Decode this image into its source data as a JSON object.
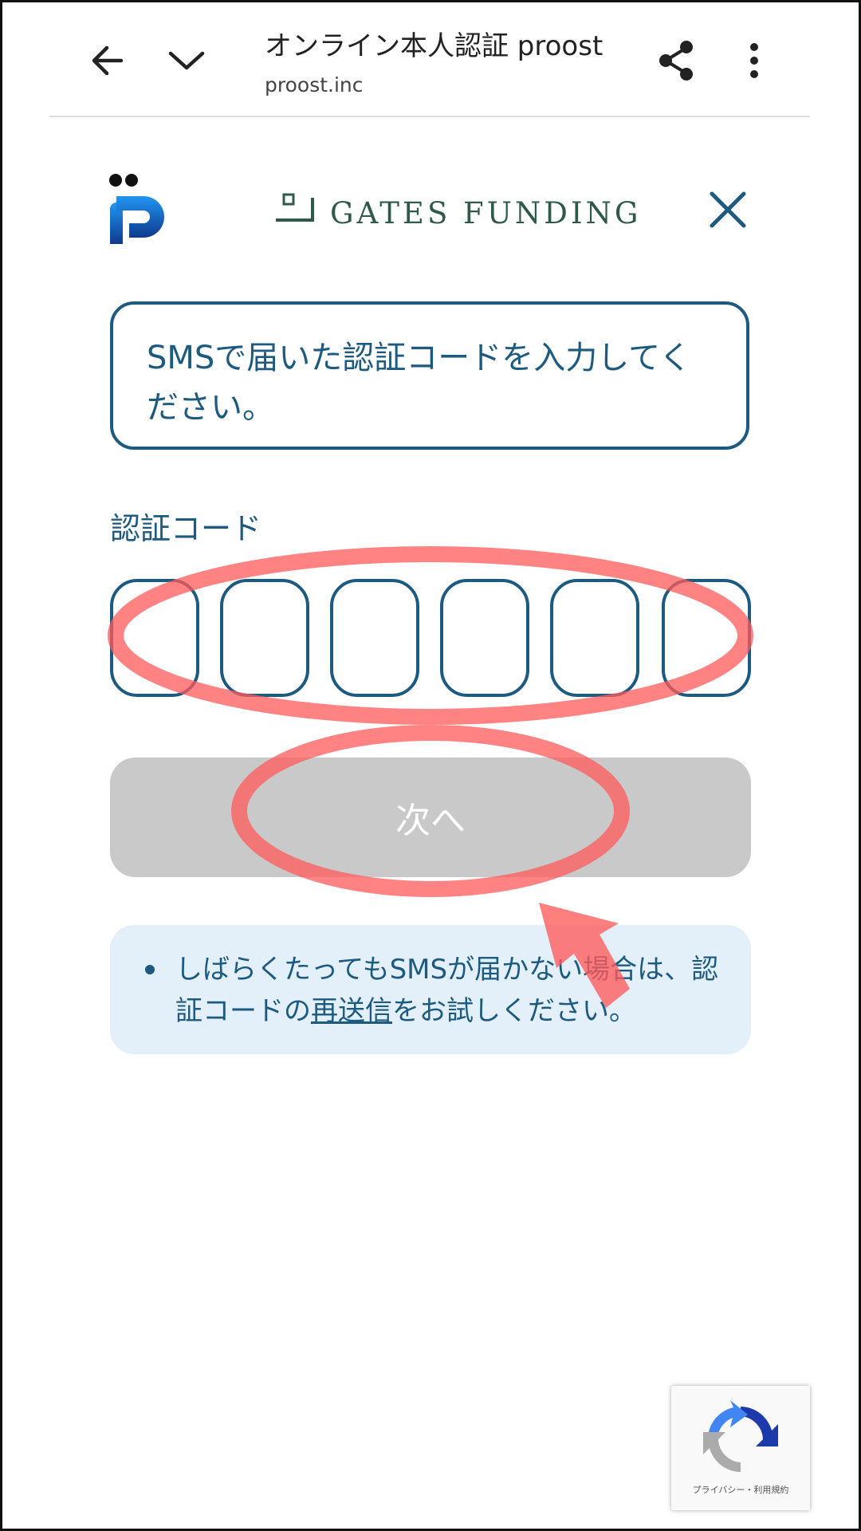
{
  "browser": {
    "title": "オンライン本人認証 proost",
    "url": "proost.inc"
  },
  "header": {
    "partner_logo_text": "GATES FUNDING"
  },
  "instruction": "SMSで届いた認証コードを入力してください。",
  "code_label": "認証コード",
  "code_digits": [
    "",
    "",
    "",
    "",
    "",
    ""
  ],
  "next_button": "次へ",
  "notice": {
    "prefix": "しばらくたってもSMSが届かない場合は、認証コードの",
    "link": "再送信",
    "suffix": "をお試しください。"
  },
  "recaptcha": {
    "label": "プライバシー・利用規約"
  },
  "colors": {
    "primary": "#1d5a80",
    "button_disabled": "#c9c9c9",
    "notice_bg": "#e3f0fa",
    "annotation": "#ff5a5a"
  }
}
